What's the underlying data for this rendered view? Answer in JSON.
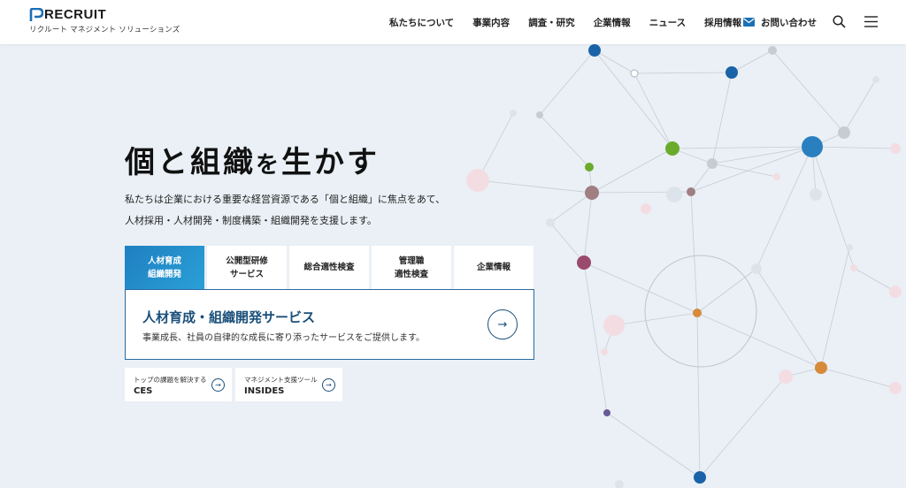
{
  "header": {
    "logo_text": "RECRUIT",
    "logo_sub": "リクルート マネジメント ソリューションズ",
    "nav": [
      "私たちについて",
      "事業内容",
      "調査・研究",
      "企業情報",
      "ニュース",
      "採用情報"
    ],
    "contact_label": "お問い合わせ",
    "search_icon": "search-icon",
    "menu_icon": "hamburger-menu-icon"
  },
  "hero": {
    "title_part1": "個と組織",
    "title_part2": "を",
    "title_part3": "生かす",
    "desc_line1": "私たちは企業における重要な経営資源である「個と組織」に焦点をあて、",
    "desc_line2": "人材採用・人材開発・制度構築・組織開発を支援します。"
  },
  "tabs": [
    {
      "label": "人材育成\n組織開発",
      "active": true
    },
    {
      "label": "公開型研修\nサービス",
      "active": false
    },
    {
      "label": "総合適性検査",
      "active": false
    },
    {
      "label": "管理職\n適性検査",
      "active": false
    },
    {
      "label": "企業情報",
      "active": false
    }
  ],
  "panel": {
    "title": "人材育成・組織開発サービス",
    "desc": "事業成長、社員の自律的な成長に寄り添ったサービスをご提供します。",
    "arrow": "→"
  },
  "cards": [
    {
      "sub": "トップの課題を解決する",
      "name": "CES",
      "arrow": "→"
    },
    {
      "sub": "マネジメント支援ツール",
      "name": "INSIDES",
      "arrow": "→"
    }
  ],
  "colors": {
    "accent": "#1f7fc0",
    "panel_border": "#2a6aa0",
    "title_blue": "#1a4f7a",
    "background": "#eaf0f5"
  }
}
